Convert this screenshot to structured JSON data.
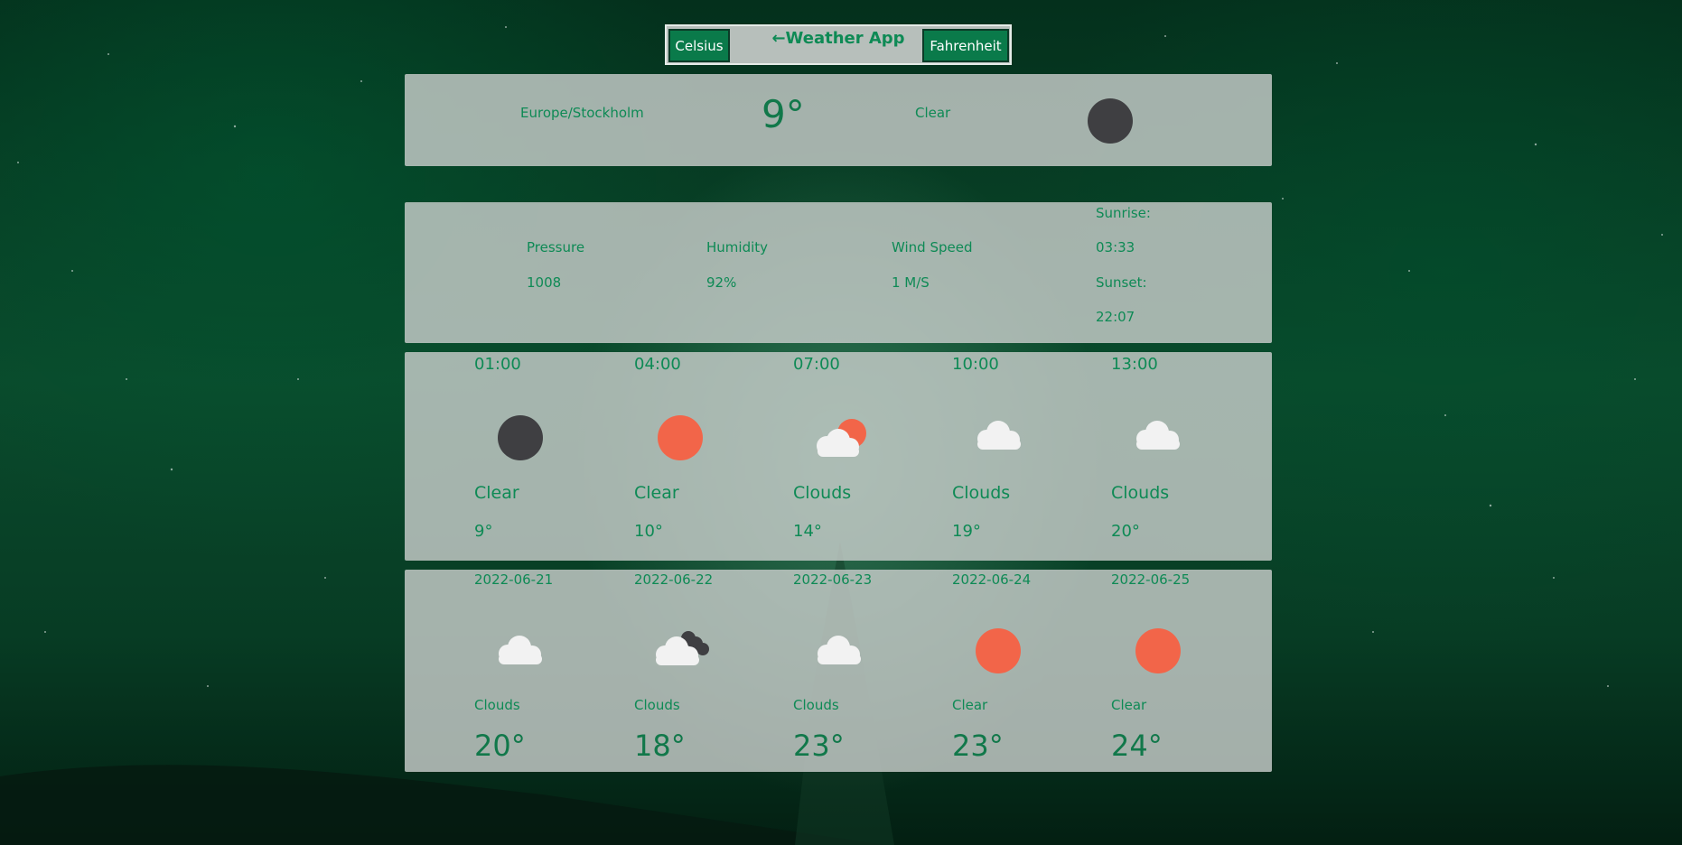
{
  "header": {
    "celsius_label": "Celsius",
    "title": "←Weather App",
    "fahrenheit_label": "Fahrenheit"
  },
  "current": {
    "location": "Europe/Stockholm",
    "temperature": "9°",
    "condition": "Clear",
    "icon": "moon-icon"
  },
  "details": {
    "pressure_label": "Pressure",
    "pressure_value": "1008",
    "humidity_label": "Humidity",
    "humidity_value": "92%",
    "wind_label": "Wind Speed",
    "wind_value": "1 M/S",
    "sunrise_label": "Sunrise:",
    "sunrise_value": "03:33",
    "sunset_label": "Sunset:",
    "sunset_value": "22:07"
  },
  "hourly": [
    {
      "time": "01:00",
      "icon": "moon-icon",
      "condition": "Clear",
      "temp": "9°"
    },
    {
      "time": "04:00",
      "icon": "sun-icon",
      "condition": "Clear",
      "temp": "10°"
    },
    {
      "time": "07:00",
      "icon": "sun-behind-cloud-icon",
      "condition": "Clouds",
      "temp": "14°"
    },
    {
      "time": "10:00",
      "icon": "cloud-icon",
      "condition": "Clouds",
      "temp": "19°"
    },
    {
      "time": "13:00",
      "icon": "cloud-icon",
      "condition": "Clouds",
      "temp": "20°"
    }
  ],
  "daily": [
    {
      "date": "2022-06-21",
      "icon": "cloud-icon",
      "condition": "Clouds",
      "temp": "20°"
    },
    {
      "date": "2022-06-22",
      "icon": "dark-clouds-icon",
      "condition": "Clouds",
      "temp": "18°"
    },
    {
      "date": "2022-06-23",
      "icon": "cloud-icon",
      "condition": "Clouds",
      "temp": "23°"
    },
    {
      "date": "2022-06-24",
      "icon": "sun-icon",
      "condition": "Clear",
      "temp": "23°"
    },
    {
      "date": "2022-06-25",
      "icon": "sun-icon",
      "condition": "Clear",
      "temp": "24°"
    }
  ],
  "colors": {
    "accent_text": "#0e8a55",
    "button_bg": "#0a7a4a",
    "sun": "#f26549",
    "moon": "#3f3f42",
    "cloud": "#f2f2f2"
  }
}
